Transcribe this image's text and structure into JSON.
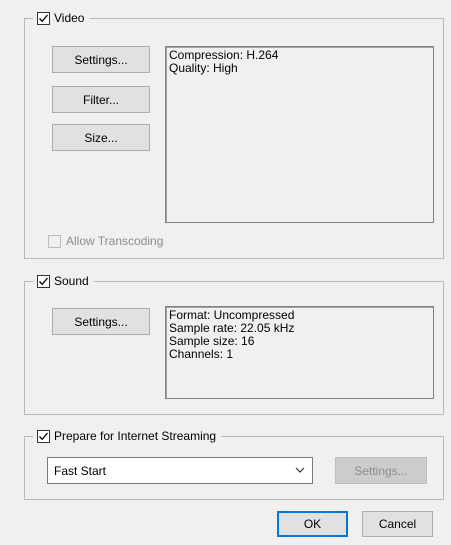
{
  "video": {
    "title": "Video",
    "checked": true,
    "settings_label": "Settings...",
    "filter_label": "Filter...",
    "size_label": "Size...",
    "info_lines": [
      "Compression: H.264",
      "Quality: High"
    ],
    "allow_transcoding_label": "Allow Transcoding",
    "allow_transcoding_checked": false
  },
  "sound": {
    "title": "Sound",
    "checked": true,
    "settings_label": "Settings...",
    "info_lines": [
      "Format: Uncompressed",
      "Sample rate: 22.05 kHz",
      "Sample size: 16",
      "Channels: 1"
    ]
  },
  "streaming": {
    "title": "Prepare for Internet Streaming",
    "checked": true,
    "selected": "Fast Start",
    "settings_label": "Settings..."
  },
  "footer": {
    "ok_label": "OK",
    "cancel_label": "Cancel"
  },
  "colors": {
    "background": "#f0f0f0",
    "accent": "#0078d7"
  }
}
